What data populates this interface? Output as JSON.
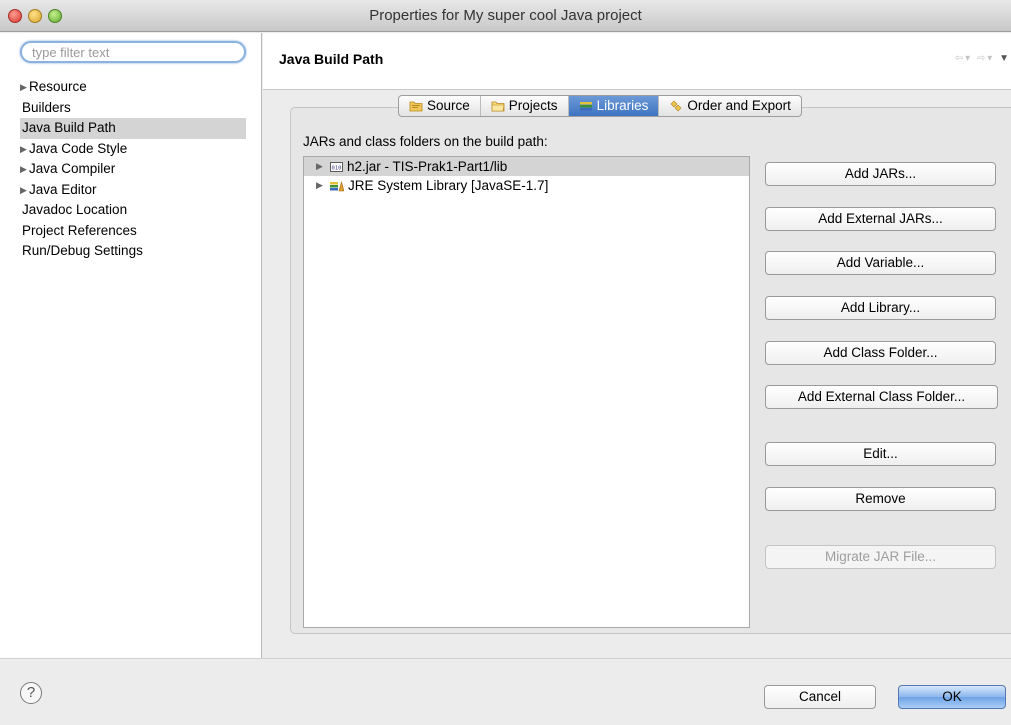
{
  "window": {
    "title": "Properties for My super cool Java project"
  },
  "sidebar": {
    "filter_placeholder": "type filter text",
    "items": [
      {
        "label": "Resource",
        "expandable": true
      },
      {
        "label": "Builders",
        "expandable": false
      },
      {
        "label": "Java Build Path",
        "expandable": false,
        "selected": true
      },
      {
        "label": "Java Code Style",
        "expandable": true
      },
      {
        "label": "Java Compiler",
        "expandable": true
      },
      {
        "label": "Java Editor",
        "expandable": true
      },
      {
        "label": "Javadoc Location",
        "expandable": false
      },
      {
        "label": "Project References",
        "expandable": false
      },
      {
        "label": "Run/Debug Settings",
        "expandable": false
      }
    ]
  },
  "header": {
    "title": "Java Build Path"
  },
  "tabs": [
    {
      "label": "Source",
      "icon": "source-folder-icon"
    },
    {
      "label": "Projects",
      "icon": "projects-folder-icon"
    },
    {
      "label": "Libraries",
      "icon": "libraries-icon",
      "active": true
    },
    {
      "label": "Order and Export",
      "icon": "order-export-icon"
    }
  ],
  "libraries": {
    "label": "JARs and class folders on the build path:",
    "entries": [
      {
        "label": "h2.jar - TIS-Prak1-Part1/lib",
        "icon": "jar-icon"
      },
      {
        "label": "JRE System Library [JavaSE-1.7]",
        "icon": "library-icon"
      }
    ],
    "buttons": {
      "add_jars": "Add JARs...",
      "add_external_jars": "Add External JARs...",
      "add_variable": "Add Variable...",
      "add_library": "Add Library...",
      "add_class_folder": "Add Class Folder...",
      "add_external_class_folder": "Add External Class Folder...",
      "edit": "Edit...",
      "remove": "Remove",
      "migrate_jar": "Migrate JAR File..."
    }
  },
  "footer": {
    "help": "?",
    "cancel": "Cancel",
    "ok": "OK"
  }
}
